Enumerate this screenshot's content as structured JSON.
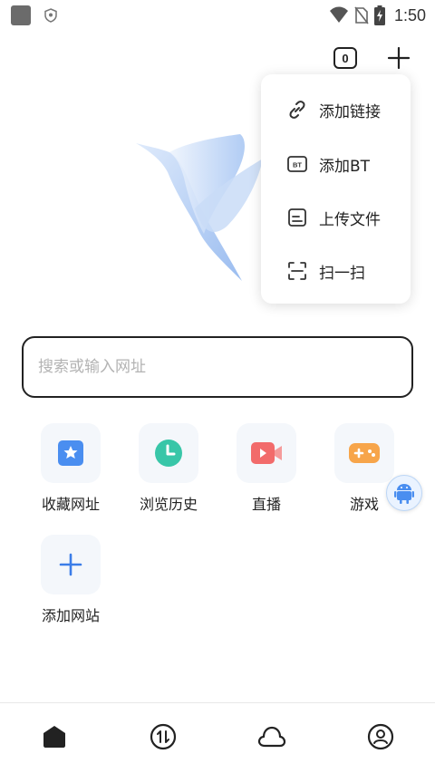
{
  "status_bar": {
    "time": "1:50"
  },
  "top_bar": {
    "tab_count": "0"
  },
  "menu": {
    "items": [
      {
        "label": "添加链接",
        "icon": "link-icon"
      },
      {
        "label": "添加BT",
        "icon": "bt-icon",
        "badge": "BT"
      },
      {
        "label": "上传文件",
        "icon": "file-icon"
      },
      {
        "label": "扫一扫",
        "icon": "scan-icon"
      }
    ]
  },
  "search": {
    "placeholder": "搜索或输入网址"
  },
  "quick_links": [
    {
      "label": "收藏网址",
      "icon": "bookmark-star-icon",
      "color": "#4a8ef0"
    },
    {
      "label": "浏览历史",
      "icon": "clock-icon",
      "color": "#38c6a8"
    },
    {
      "label": "直播",
      "icon": "video-icon",
      "color": "#f26b6b"
    },
    {
      "label": "游戏",
      "icon": "gamepad-icon",
      "color": "#f7a54a"
    },
    {
      "label": "添加网站",
      "icon": "plus-icon",
      "color": "#3b7de8"
    }
  ],
  "bottom_nav": [
    "home-icon",
    "transfer-icon",
    "cloud-icon",
    "profile-icon"
  ]
}
